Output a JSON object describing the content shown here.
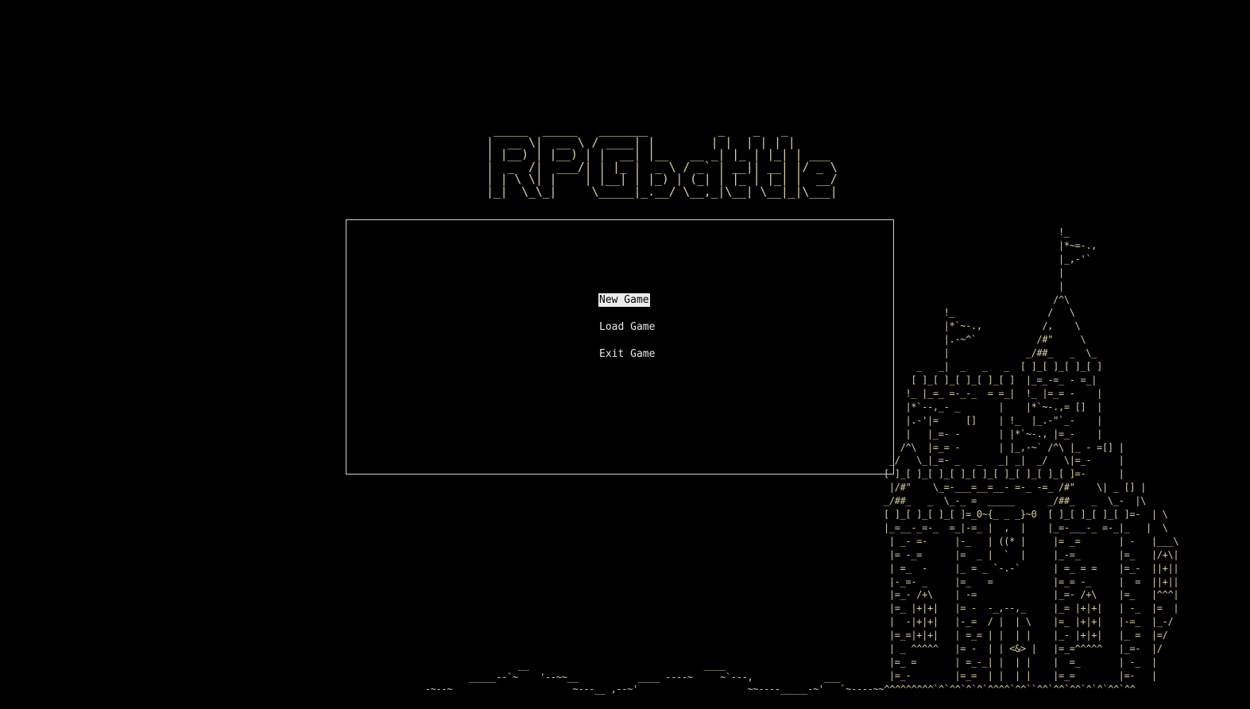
{
  "menu": {
    "items": [
      {
        "label": "New Game",
        "selected": true
      },
      {
        "label": "Load Game",
        "selected": false
      },
      {
        "label": "Exit Game",
        "selected": false
      }
    ]
  },
  "art": {
    "logo_text": "RPGBattle",
    "castle": "castle-ascii-art",
    "ground": "ground-ascii-art"
  },
  "colors": {
    "background": "#000000",
    "art": "#d9cf9e",
    "menu_text": "#e8e8e8",
    "selection_bg": "#ececec",
    "border": "#d0d0d0"
  }
}
